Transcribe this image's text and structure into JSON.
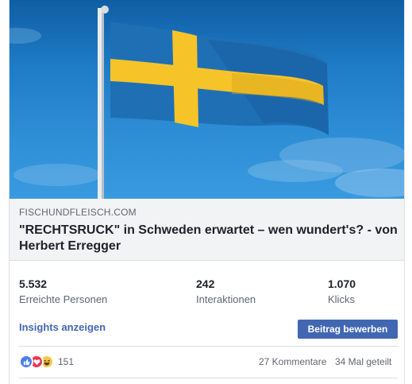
{
  "link_preview": {
    "image_alt": "Swedish flag",
    "domain": "FISCHUNDFLEISCH.COM",
    "headline": "\"RECHTSRUCK\" in Schweden erwartet – wen wundert's? - von Herbert Erregger"
  },
  "stats": [
    {
      "value": "5.532",
      "label": "Erreichte Personen"
    },
    {
      "value": "242",
      "label": "Interaktionen"
    },
    {
      "value": "1.070",
      "label": "Klicks"
    }
  ],
  "actions": {
    "insights_label": "Insights anzeigen",
    "boost_label": "Beitrag bewerben"
  },
  "engagement": {
    "reaction_icons": [
      "like-icon",
      "love-icon",
      "haha-icon"
    ],
    "reaction_count": "151",
    "comments": "27 Kommentare",
    "shares": "34 Mal geteilt"
  },
  "colors": {
    "accent": "#4267b2",
    "flag_blue": "#1f6fb5",
    "flag_yellow": "#f6c428"
  }
}
